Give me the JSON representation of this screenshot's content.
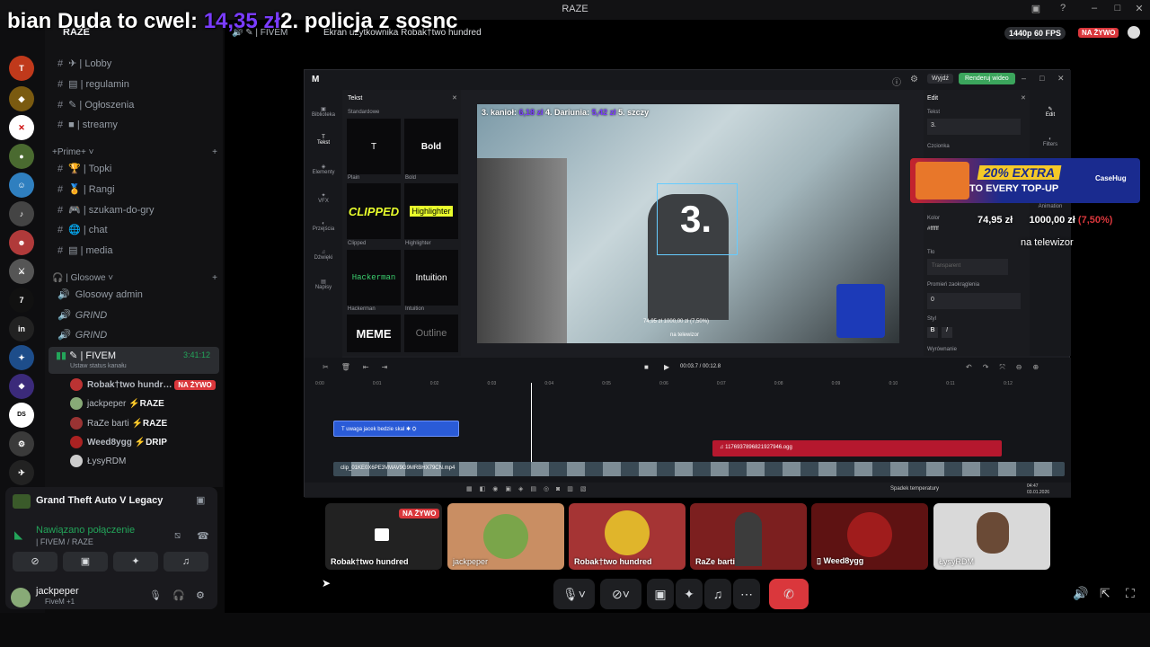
{
  "window": {
    "title": "RAZE"
  },
  "overlay": {
    "ticker_a": "bian Duda to cwel: ",
    "ticker_price": "14,35 zł",
    "ticker_b": "2. policja z sosnc"
  },
  "server": {
    "name": "RAZE"
  },
  "channels": {
    "top": [
      {
        "emoji": "✈",
        "name": "| Lobby"
      },
      {
        "emoji": "▤",
        "name": "| regulamin"
      },
      {
        "emoji": "✎",
        "name": "| Ogłoszenia"
      },
      {
        "emoji": "■",
        "name": "| streamy"
      }
    ],
    "prime_category": "+Prime+",
    "prime": [
      {
        "emoji": "🏆",
        "name": "| Topki"
      },
      {
        "emoji": "🏅",
        "name": "| Rangi"
      },
      {
        "emoji": "🎮",
        "name": "| szukam-do-gry"
      },
      {
        "emoji": "🌐",
        "name": "| chat"
      },
      {
        "emoji": "▤",
        "name": "| media"
      }
    ],
    "voice_category": "| Glosowe",
    "voice": [
      {
        "name": "Glosowy admin"
      },
      {
        "name": "GRIND"
      },
      {
        "name": "GRIND"
      }
    ],
    "active": {
      "name": "| FIVEM",
      "timer": "3:41:12",
      "status": "Ustaw status kanału"
    },
    "voice_users": [
      {
        "name": "Robak†two hundr…",
        "tag": "",
        "live": "NA ŻYWO"
      },
      {
        "name": "jackpeper",
        "tag": "⚡RAZE",
        "live": ""
      },
      {
        "name": "RaZe barti",
        "tag": "⚡RAZE",
        "live": ""
      },
      {
        "name": "Weed8ygg",
        "tag": "⚡DRIP",
        "live": ""
      },
      {
        "name": "ŁysyRDM",
        "tag": "",
        "live": ""
      }
    ]
  },
  "activity": {
    "game": "Grand Theft Auto V Legacy",
    "connection": "Nawiązano połączenie",
    "channel": "| FIVEM / RAZE"
  },
  "user": {
    "name": "jackpeper",
    "status": "FiveM +1"
  },
  "stage": {
    "channel": "| FIVEM",
    "screen_label": "Ekran użytkownika Robak†two hundred",
    "quality": "1440p 60 FPS",
    "live": "NA ŻYWO"
  },
  "editor": {
    "exit": "Wyjdź",
    "render": "Renderuj wideo",
    "tools": [
      "Biblioteka",
      "Tekst",
      "Elementy",
      "VFX",
      "Przejścia",
      "Dźwięki",
      "Napisy"
    ],
    "text_panel": {
      "title": "Tekst",
      "section": "Standardowe",
      "tiles": [
        {
          "preview": "T",
          "label": "Plain"
        },
        {
          "preview": "Bold",
          "label": "Bold"
        },
        {
          "preview": "CLIPPED",
          "label": "Clipped"
        },
        {
          "preview": "Highlighter",
          "label": "Highlighter"
        },
        {
          "preview": "Hackerman",
          "label": "Hackerman"
        },
        {
          "preview": "Intuition",
          "label": "Intuition"
        },
        {
          "preview": "MEME",
          "label": ""
        },
        {
          "preview": "Outline",
          "label": ""
        }
      ]
    },
    "preview": {
      "overlay_text_a": "3. kanioł: ",
      "overlay_price": "6,18 zł",
      "overlay_text_b": " 4. Dariunia: ",
      "overlay_price2": "5,42 zł",
      "overlay_text_c": " 5. szczy",
      "big": "3.",
      "donation": "74,95 zł   1000,00 zł (7,50%)",
      "tv": "na telewizor"
    },
    "props": {
      "title": "Edit",
      "text_label": "Tekst",
      "text_value": "3.",
      "font_label": "Czcionka",
      "color_label": "Kolor",
      "color_value": "#ffffff",
      "bg_label": "Tło",
      "bg_value": "Transparent",
      "radius_label": "Promień zaokrąglenia",
      "radius_value": "0",
      "style_label": "Styl",
      "align_label": "Wyrównanie"
    },
    "side": [
      "Edit",
      "Filters",
      "Animation"
    ],
    "time": "00:03.7 / 00:12.8",
    "ticks": [
      "0:00",
      "0:01",
      "0:02",
      "0:03",
      "0:04",
      "0:05",
      "0:06",
      "0:07",
      "0:08",
      "0:09",
      "0:10",
      "0:11",
      "0:12"
    ],
    "clip_text": "uwaga jacek bedzie skal",
    "clip_audio": "1176937896821927946.ogg",
    "clip_video": "clip_01KE0X6PE3VMAV9G9MRBHX79CN.mp4",
    "taskbar_weather": "Spadek temperatury",
    "taskbar_time": "04:47",
    "taskbar_date": "03.01.2026"
  },
  "ad": {
    "line1": "20% EXTRA",
    "line2": "TO EVERY TOP-UP",
    "brand": "CaseHug"
  },
  "overlay_donation": {
    "amount": "74,95 zł",
    "goal": "1000,00 zł",
    "pct": "(7,50%)",
    "tv": "na telewizor"
  },
  "tiles": [
    {
      "name": "Robak†two hundred",
      "live": "NA ŻYWO"
    },
    {
      "name": "jackpeper",
      "live": ""
    },
    {
      "name": "Robak†two hundred",
      "live": ""
    },
    {
      "name": "RaZe barti",
      "live": ""
    },
    {
      "name": "Weed8ygg",
      "live": ""
    },
    {
      "name": "ŁysyRDM",
      "live": ""
    }
  ],
  "colors": {
    "live": "#da373c",
    "accent": "#7a3cff",
    "connected": "#23a55a",
    "render": "#3ba55c"
  }
}
